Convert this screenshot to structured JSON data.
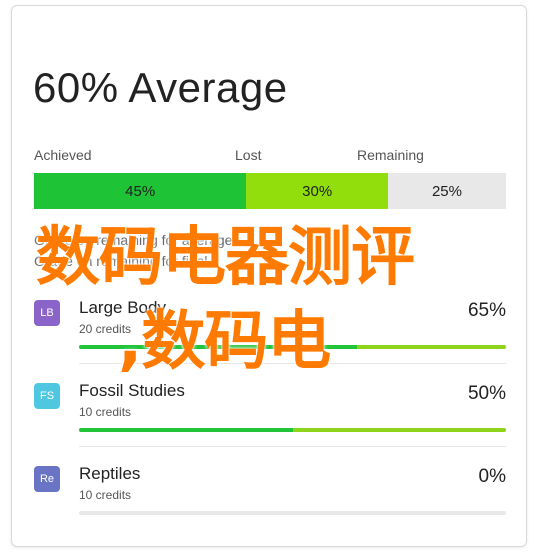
{
  "title": "60% Average",
  "segments": [
    {
      "label": "Achieved",
      "value": "45%",
      "percent": 45,
      "color": "#1ec435"
    },
    {
      "label": "Lost",
      "value": "30%",
      "percent": 30,
      "color": "#92dd0c"
    },
    {
      "label": "Remaining",
      "value": "25%",
      "percent": 25,
      "color": "#e8e8e8"
    }
  ],
  "note_line1": "Grade on remaining for average",
  "note_line2": "Grade on remaining for final",
  "watermark_line1": "数码电器测评",
  "watermark_line2": ",数码电",
  "courses": [
    {
      "badge": "LB",
      "badge_color": "#8b64c9",
      "name": "Large Body",
      "credits": "20 credits",
      "percent_label": "65%",
      "achieved": 0.65,
      "total": 1.0
    },
    {
      "badge": "FS",
      "badge_color": "#4fc7e0",
      "name": "Fossil Studies",
      "credits": "10 credits",
      "percent_label": "50%",
      "achieved": 0.5,
      "total": 1.0
    },
    {
      "badge": "Re",
      "badge_color": "#6a74c4",
      "name": "Reptiles",
      "credits": "10 credits",
      "percent_label": "0%",
      "achieved": 0.0,
      "total": 0.0
    }
  ]
}
